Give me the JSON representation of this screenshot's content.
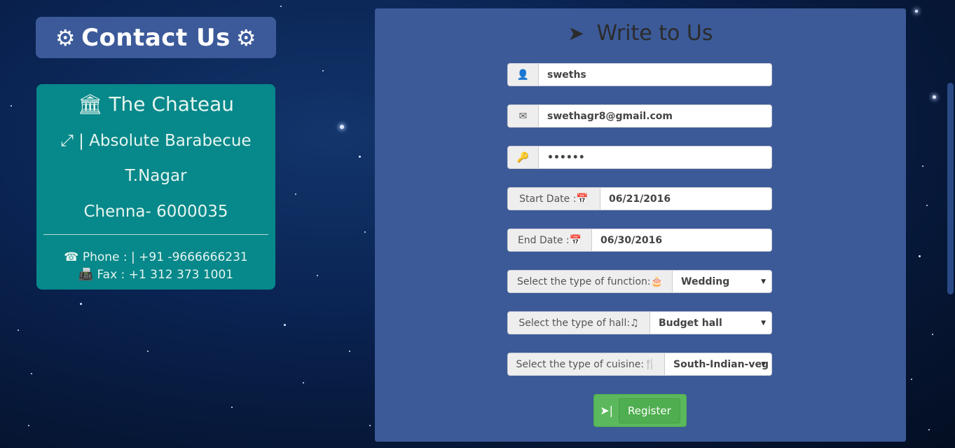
{
  "contact": {
    "title": "Contact Us",
    "gear_icon": "gear-icon",
    "venue_name": "The Chateau",
    "restaurant": "| Absolute Barabecue",
    "area": "T.Nagar",
    "city": "Chenna- 6000035",
    "phone_label": "Phone :",
    "phone_value": "| +91 -9666666231",
    "fax_label": "Fax :",
    "fax_value": "+1 312 373 1001"
  },
  "form": {
    "title": "Write to Us",
    "name_value": "sweths",
    "email_value": "swethagr8@gmail.com",
    "password_value": "••••••",
    "start_date_label": "Start Date :",
    "start_date_value": "06/21/2016",
    "end_date_label": "End Date :",
    "end_date_value": "06/30/2016",
    "function_label": "Select the type of function:",
    "function_value": "Wedding",
    "hall_label": "Select the type of hall:",
    "hall_value": "Budget hall",
    "cuisine_label": "Select the type of cuisine:",
    "cuisine_value": "South-Indian-veg",
    "register_label": "Register"
  },
  "colors": {
    "panel": "#3c5a98",
    "card": "#07888a",
    "button": "#5cb85c"
  }
}
